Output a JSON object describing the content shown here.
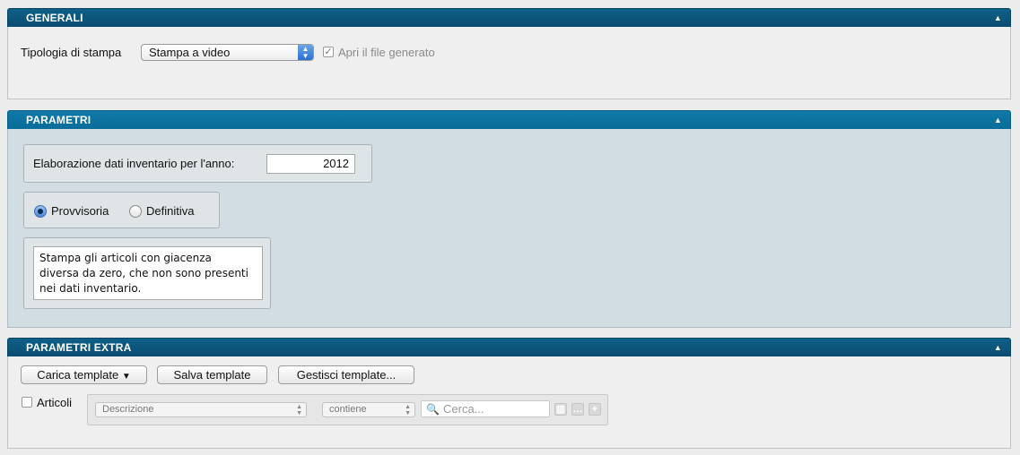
{
  "generali": {
    "title": "GENERALI",
    "print_type_label": "Tipologia di stampa",
    "print_type_value": "Stampa a video",
    "open_file_label": "Apri il file generato",
    "open_file_checked": true
  },
  "parametri": {
    "title": "PARAMETRI",
    "year_label": "Elaborazione dati inventario per l'anno:",
    "year_value": "2012",
    "radio_options": [
      {
        "label": "Provvisoria",
        "selected": true
      },
      {
        "label": "Definitiva",
        "selected": false
      }
    ],
    "notes_text": "Stampa gli articoli con giacenza\ndiversa da zero, che non sono presenti\nnei dati inventario."
  },
  "parametri_extra": {
    "title": "PARAMETRI EXTRA",
    "buttons": {
      "load": "Carica template",
      "save": "Salva template",
      "manage": "Gestisci template..."
    },
    "articoli_label": "Articoli",
    "articoli_checked": false,
    "filter_field": "Descrizione",
    "filter_operator": "contiene",
    "search_placeholder": "Cerca..."
  },
  "icons": {
    "collapse": "chevron-up-icon",
    "popup": "updown-arrows-icon",
    "search": "search-icon",
    "columns": "columns-icon",
    "more": "ellipsis-icon",
    "add": "plus-icon"
  },
  "colors": {
    "header_dark": "#0a4d70",
    "header_light": "#0a6c98",
    "param_bg": "#d2dde3"
  }
}
